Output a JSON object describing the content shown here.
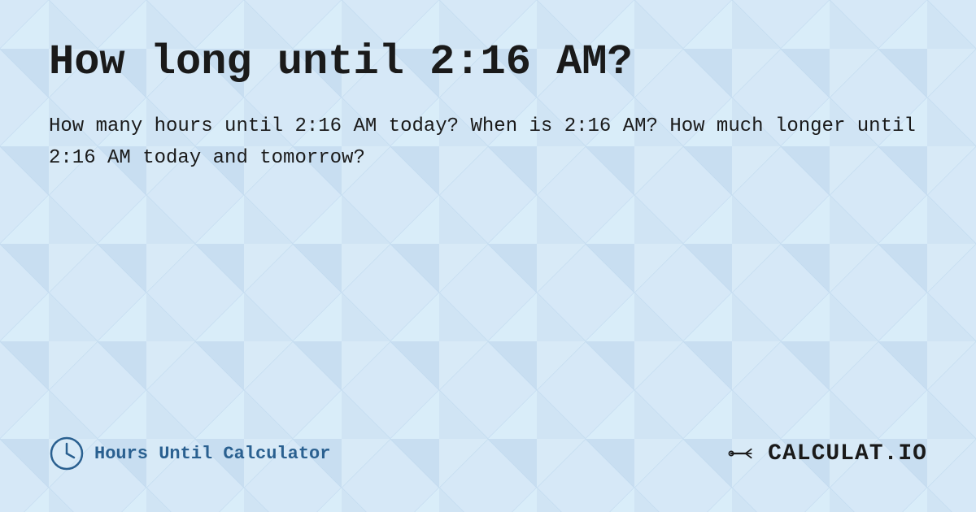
{
  "page": {
    "title": "How long until 2:16 AM?",
    "description": "How many hours until 2:16 AM today? When is 2:16 AM? How much longer until 2:16 AM today and tomorrow?",
    "footer": {
      "left_text": "Hours Until Calculator",
      "logo_text": "CALCULAT.IO"
    },
    "background_color": "#d6e8f7",
    "pattern_color_light": "#c8dff2",
    "pattern_color_lighter": "#e2eff9"
  }
}
